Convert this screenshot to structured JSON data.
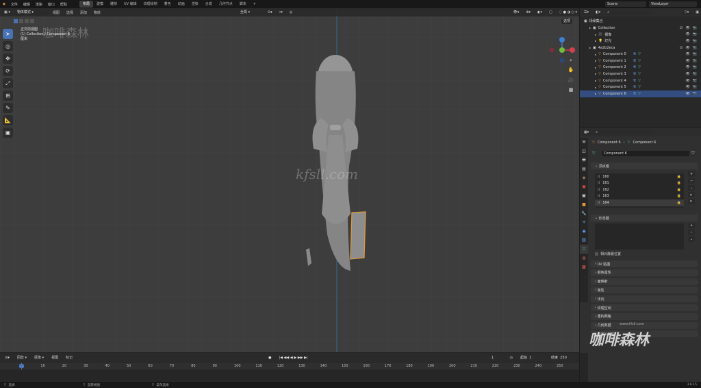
{
  "topbar": {
    "menus": [
      "文件",
      "编辑",
      "渲染",
      "窗口",
      "帮助"
    ],
    "workspaces": [
      "布局",
      "建模",
      "雕刻",
      "UV 编辑",
      "纹理绘制",
      "着色",
      "动画",
      "渲染",
      "合成",
      "几何节点",
      "脚本"
    ],
    "active_workspace": "布局",
    "scene_value": "Scene",
    "view_layer_value": "ViewLayer"
  },
  "viewport_header": {
    "mode": "物体模式",
    "menus": [
      "视图",
      "选择",
      "添加",
      "物体"
    ],
    "orientation": "全局",
    "options_label": "选项"
  },
  "viewport_info": {
    "line1": "正交前视图",
    "line2": "(1) Collection | Component 6",
    "line3": "厘米"
  },
  "watermark_center": "kfsll.com",
  "watermark_top": "咖啡森林",
  "outliner": {
    "root": "场景集合",
    "rows": [
      {
        "label": "Collection",
        "indent": 1,
        "icon": "collection-icon",
        "selected": false
      },
      {
        "label": "摄像",
        "indent": 2,
        "icon": "camera-icon",
        "selected": false
      },
      {
        "label": "灯光",
        "indent": 2,
        "icon": "light-icon",
        "selected": false
      },
      {
        "label": "4a2b2eca",
        "indent": 1,
        "icon": "collection-icon",
        "selected": false
      },
      {
        "label": "Component 0",
        "indent": 2,
        "icon": "mesh-icon",
        "selected": false
      },
      {
        "label": "Component 1",
        "indent": 2,
        "icon": "mesh-icon",
        "selected": false
      },
      {
        "label": "Component 2",
        "indent": 2,
        "icon": "mesh-icon",
        "selected": false
      },
      {
        "label": "Component 3",
        "indent": 2,
        "icon": "mesh-icon",
        "selected": false
      },
      {
        "label": "Component 4",
        "indent": 2,
        "icon": "mesh-icon",
        "selected": false
      },
      {
        "label": "Component 5",
        "indent": 2,
        "icon": "mesh-icon",
        "selected": false
      },
      {
        "label": "Component 6",
        "indent": 2,
        "icon": "mesh-icon",
        "selected": true
      }
    ]
  },
  "properties": {
    "breadcrumb_1": "Component 6",
    "breadcrumb_2": "Component 6",
    "mesh_name": "Component 6",
    "vertex_groups_title": "顶点组",
    "vertex_groups": [
      "160",
      "161",
      "162",
      "163",
      "164"
    ],
    "selected_vertex_group": "164",
    "shape_keys_title": "形态键",
    "relative_label": "相对静置位置",
    "panels": [
      "UV 贴图",
      "颜色属性",
      "面映射",
      "属性",
      "法向",
      "纹理空间",
      "重构网格",
      "几何数据",
      "自定义属性"
    ]
  },
  "timeline": {
    "menus": [
      "回放",
      "抠像",
      "视图",
      "标记"
    ],
    "current_frame": "1",
    "start_label": "起始",
    "start_value": "1",
    "end_label": "结束",
    "end_value": "250",
    "ticks": [
      "1",
      "10",
      "20",
      "30",
      "40",
      "50",
      "60",
      "70",
      "80",
      "90",
      "100",
      "110",
      "120",
      "130",
      "140",
      "150",
      "160",
      "170",
      "180",
      "190",
      "200",
      "210",
      "220",
      "230",
      "240",
      "250"
    ]
  },
  "statusbar": {
    "left": "选择",
    "mid1": "旋转视图",
    "mid2": "菜单选择",
    "version": "3.6.15"
  },
  "brand_watermark": "咖啡森林",
  "brand_small": "www.kfsll.com",
  "colors": {
    "accent": "#4772b3",
    "selected_row": "#334d80",
    "origin_orange": "#e69b3a"
  }
}
